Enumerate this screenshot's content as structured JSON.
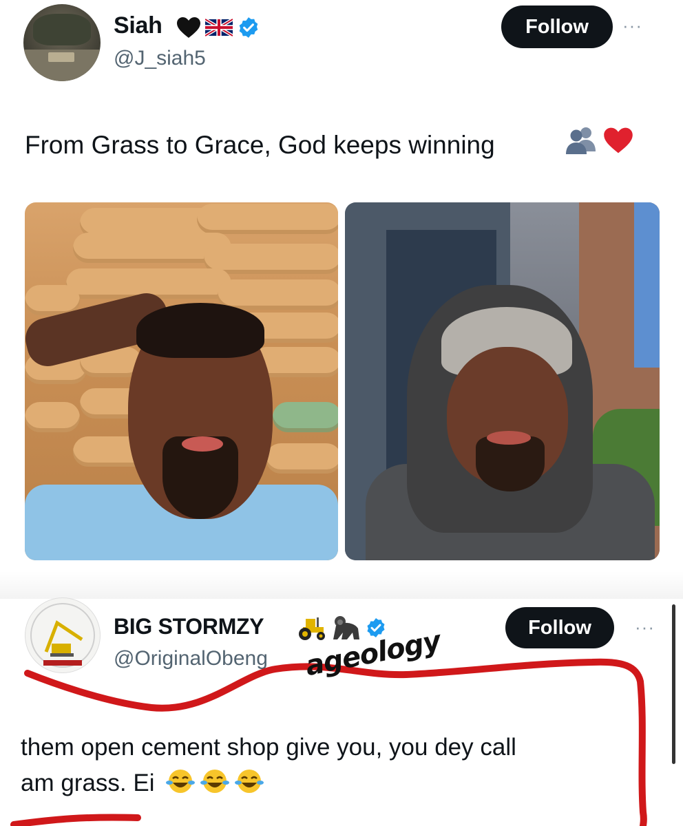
{
  "tweet1": {
    "display_name": "Siah",
    "name_badges": [
      "black-heart-icon",
      "uk-flag-icon",
      "verified-badge-icon"
    ],
    "handle": "@J_siah5",
    "follow_label": "Follow",
    "more_label": "···",
    "text": "From Grass to Grace, God keeps winning",
    "text_emojis": [
      "busts-in-silhouette-icon",
      "red-heart-icon"
    ],
    "photos": [
      {
        "name": "before-photo",
        "description_icon": "cement-bags-selfie"
      },
      {
        "name": "after-photo",
        "description_icon": "hoodie-selfie"
      }
    ]
  },
  "tweet2": {
    "display_name": "BIG STORMZY",
    "name_badges": [
      "tractor-icon",
      "gorilla-icon",
      "verified-badge-icon"
    ],
    "handle": "@OriginalObeng",
    "follow_label": "Follow",
    "more_label": "···",
    "text_line1": "them open cement shop give you, you dey call",
    "text_line2": "am grass. Ei",
    "text_emojis": [
      "tears-of-joy-icon",
      "tears-of-joy-icon",
      "tears-of-joy-icon"
    ]
  },
  "watermark": "ageology",
  "colors": {
    "follow_bg": "#0f1419",
    "handle": "#536471",
    "verified": "#1d9bf0",
    "annotation_red": "#d0181a"
  }
}
